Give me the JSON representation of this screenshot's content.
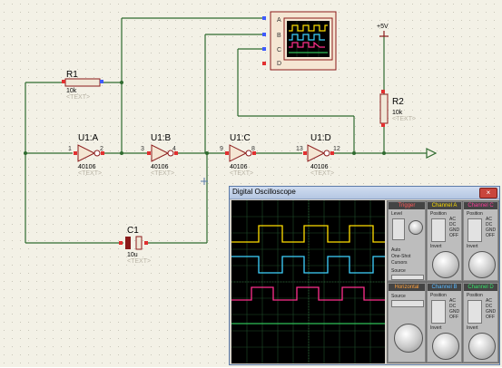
{
  "schematic": {
    "r1": {
      "name": "R1",
      "value": "10k",
      "text": "<TEXT>"
    },
    "r2": {
      "name": "R2",
      "value": "10k",
      "text": "<TEXT>"
    },
    "c1": {
      "name": "C1",
      "value": "10u",
      "text": "<TEXT>"
    },
    "power": {
      "label": "+5V"
    },
    "u1a": {
      "name": "U1:A",
      "part": "40106",
      "text": "<TEXT>",
      "pin_in": "1",
      "pin_out": "2"
    },
    "u1b": {
      "name": "U1:B",
      "part": "40106",
      "text": "<TEXT>",
      "pin_in": "3",
      "pin_out": "4"
    },
    "u1c": {
      "name": "U1:C",
      "part": "40106",
      "text": "<TEXT>",
      "pin_in": "9",
      "pin_out": "8"
    },
    "u1d": {
      "name": "U1:D",
      "part": "40106",
      "text": "<TEXT>",
      "pin_in": "13",
      "pin_out": "12"
    },
    "scope_pins": [
      "A",
      "B",
      "C",
      "D"
    ]
  },
  "oscilloscope": {
    "title": "Digital Oscilloscope",
    "close_label": "×",
    "trigger": {
      "title": "Trigger",
      "level_label": "Level",
      "auto_label": "Auto",
      "one_shot_label": "One-Shot",
      "cursors_label": "Cursors",
      "source_label": "Source"
    },
    "horizontal": {
      "title": "Horizontal",
      "source_label": "Source"
    },
    "channels": [
      {
        "name": "Channel A",
        "color": "#ffde00",
        "coupling": [
          "AC",
          "DC",
          "GND",
          "OFF"
        ],
        "invert": "Invert",
        "position_label": "Position"
      },
      {
        "name": "Channel B",
        "color": "#59b9ff",
        "coupling": [
          "AC",
          "DC",
          "GND",
          "OFF"
        ],
        "invert": "Invert",
        "position_label": "Position"
      },
      {
        "name": "Channel C",
        "color": "#ff3b9a",
        "coupling": [
          "AC",
          "DC",
          "GND",
          "OFF"
        ],
        "invert": "Invert",
        "position_label": "Position"
      },
      {
        "name": "Channel D",
        "color": "#37e06a",
        "coupling": [
          "AC",
          "DC",
          "GND",
          "OFF"
        ],
        "invert": "Invert",
        "position_label": "Position"
      }
    ],
    "trace_colors": {
      "a": "#ffde00",
      "b": "#3fd2ff",
      "c": "#ff2f8c",
      "d": "#2fbf57",
      "grid": "#1f4d2a"
    }
  }
}
